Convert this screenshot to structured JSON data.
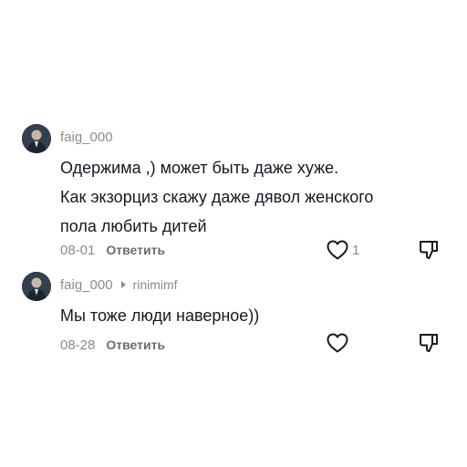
{
  "comments": [
    {
      "username": "faig_000",
      "reply_to": "",
      "text_lines": [
        "Одержима ,) может быть даже хуже.",
        "Как экзорциз скажу даже дявол женского",
        "пола любить дитей"
      ],
      "date": "08-01",
      "reply_label": "Ответить",
      "like_count": "1",
      "like_icon": "heart-outline-icon",
      "dislike_icon": "thumbs-down-icon"
    },
    {
      "username": "faig_000",
      "reply_to": "rinimimf",
      "text_lines": [
        "Мы тоже люди наверное))"
      ],
      "date": "08-28",
      "reply_label": "Ответить",
      "like_count": "",
      "like_icon": "heart-outline-icon",
      "dislike_icon": "thumbs-down-icon"
    }
  ],
  "colors": {
    "text": "#161823",
    "secondary": "#8a8b91",
    "icon": "#161823"
  }
}
